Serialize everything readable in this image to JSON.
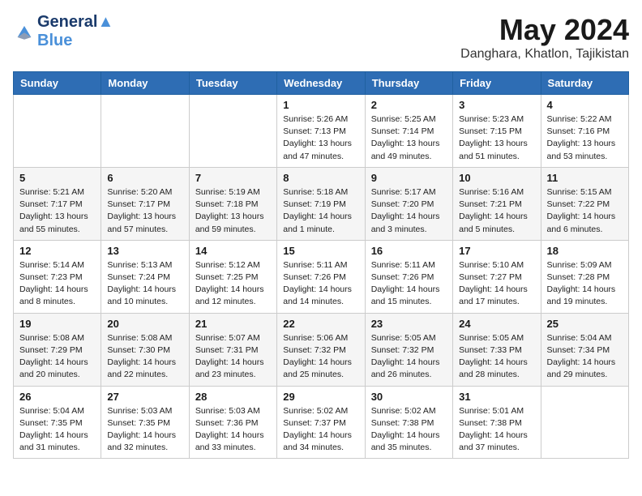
{
  "header": {
    "logo_line1": "General",
    "logo_line2": "Blue",
    "month": "May 2024",
    "location": "Danghara, Khatlon, Tajikistan"
  },
  "weekdays": [
    "Sunday",
    "Monday",
    "Tuesday",
    "Wednesday",
    "Thursday",
    "Friday",
    "Saturday"
  ],
  "weeks": [
    [
      {
        "day": "",
        "info": ""
      },
      {
        "day": "",
        "info": ""
      },
      {
        "day": "",
        "info": ""
      },
      {
        "day": "1",
        "info": "Sunrise: 5:26 AM\nSunset: 7:13 PM\nDaylight: 13 hours\nand 47 minutes."
      },
      {
        "day": "2",
        "info": "Sunrise: 5:25 AM\nSunset: 7:14 PM\nDaylight: 13 hours\nand 49 minutes."
      },
      {
        "day": "3",
        "info": "Sunrise: 5:23 AM\nSunset: 7:15 PM\nDaylight: 13 hours\nand 51 minutes."
      },
      {
        "day": "4",
        "info": "Sunrise: 5:22 AM\nSunset: 7:16 PM\nDaylight: 13 hours\nand 53 minutes."
      }
    ],
    [
      {
        "day": "5",
        "info": "Sunrise: 5:21 AM\nSunset: 7:17 PM\nDaylight: 13 hours\nand 55 minutes."
      },
      {
        "day": "6",
        "info": "Sunrise: 5:20 AM\nSunset: 7:17 PM\nDaylight: 13 hours\nand 57 minutes."
      },
      {
        "day": "7",
        "info": "Sunrise: 5:19 AM\nSunset: 7:18 PM\nDaylight: 13 hours\nand 59 minutes."
      },
      {
        "day": "8",
        "info": "Sunrise: 5:18 AM\nSunset: 7:19 PM\nDaylight: 14 hours\nand 1 minute."
      },
      {
        "day": "9",
        "info": "Sunrise: 5:17 AM\nSunset: 7:20 PM\nDaylight: 14 hours\nand 3 minutes."
      },
      {
        "day": "10",
        "info": "Sunrise: 5:16 AM\nSunset: 7:21 PM\nDaylight: 14 hours\nand 5 minutes."
      },
      {
        "day": "11",
        "info": "Sunrise: 5:15 AM\nSunset: 7:22 PM\nDaylight: 14 hours\nand 6 minutes."
      }
    ],
    [
      {
        "day": "12",
        "info": "Sunrise: 5:14 AM\nSunset: 7:23 PM\nDaylight: 14 hours\nand 8 minutes."
      },
      {
        "day": "13",
        "info": "Sunrise: 5:13 AM\nSunset: 7:24 PM\nDaylight: 14 hours\nand 10 minutes."
      },
      {
        "day": "14",
        "info": "Sunrise: 5:12 AM\nSunset: 7:25 PM\nDaylight: 14 hours\nand 12 minutes."
      },
      {
        "day": "15",
        "info": "Sunrise: 5:11 AM\nSunset: 7:26 PM\nDaylight: 14 hours\nand 14 minutes."
      },
      {
        "day": "16",
        "info": "Sunrise: 5:11 AM\nSunset: 7:26 PM\nDaylight: 14 hours\nand 15 minutes."
      },
      {
        "day": "17",
        "info": "Sunrise: 5:10 AM\nSunset: 7:27 PM\nDaylight: 14 hours\nand 17 minutes."
      },
      {
        "day": "18",
        "info": "Sunrise: 5:09 AM\nSunset: 7:28 PM\nDaylight: 14 hours\nand 19 minutes."
      }
    ],
    [
      {
        "day": "19",
        "info": "Sunrise: 5:08 AM\nSunset: 7:29 PM\nDaylight: 14 hours\nand 20 minutes."
      },
      {
        "day": "20",
        "info": "Sunrise: 5:08 AM\nSunset: 7:30 PM\nDaylight: 14 hours\nand 22 minutes."
      },
      {
        "day": "21",
        "info": "Sunrise: 5:07 AM\nSunset: 7:31 PM\nDaylight: 14 hours\nand 23 minutes."
      },
      {
        "day": "22",
        "info": "Sunrise: 5:06 AM\nSunset: 7:32 PM\nDaylight: 14 hours\nand 25 minutes."
      },
      {
        "day": "23",
        "info": "Sunrise: 5:05 AM\nSunset: 7:32 PM\nDaylight: 14 hours\nand 26 minutes."
      },
      {
        "day": "24",
        "info": "Sunrise: 5:05 AM\nSunset: 7:33 PM\nDaylight: 14 hours\nand 28 minutes."
      },
      {
        "day": "25",
        "info": "Sunrise: 5:04 AM\nSunset: 7:34 PM\nDaylight: 14 hours\nand 29 minutes."
      }
    ],
    [
      {
        "day": "26",
        "info": "Sunrise: 5:04 AM\nSunset: 7:35 PM\nDaylight: 14 hours\nand 31 minutes."
      },
      {
        "day": "27",
        "info": "Sunrise: 5:03 AM\nSunset: 7:35 PM\nDaylight: 14 hours\nand 32 minutes."
      },
      {
        "day": "28",
        "info": "Sunrise: 5:03 AM\nSunset: 7:36 PM\nDaylight: 14 hours\nand 33 minutes."
      },
      {
        "day": "29",
        "info": "Sunrise: 5:02 AM\nSunset: 7:37 PM\nDaylight: 14 hours\nand 34 minutes."
      },
      {
        "day": "30",
        "info": "Sunrise: 5:02 AM\nSunset: 7:38 PM\nDaylight: 14 hours\nand 35 minutes."
      },
      {
        "day": "31",
        "info": "Sunrise: 5:01 AM\nSunset: 7:38 PM\nDaylight: 14 hours\nand 37 minutes."
      },
      {
        "day": "",
        "info": ""
      }
    ]
  ]
}
